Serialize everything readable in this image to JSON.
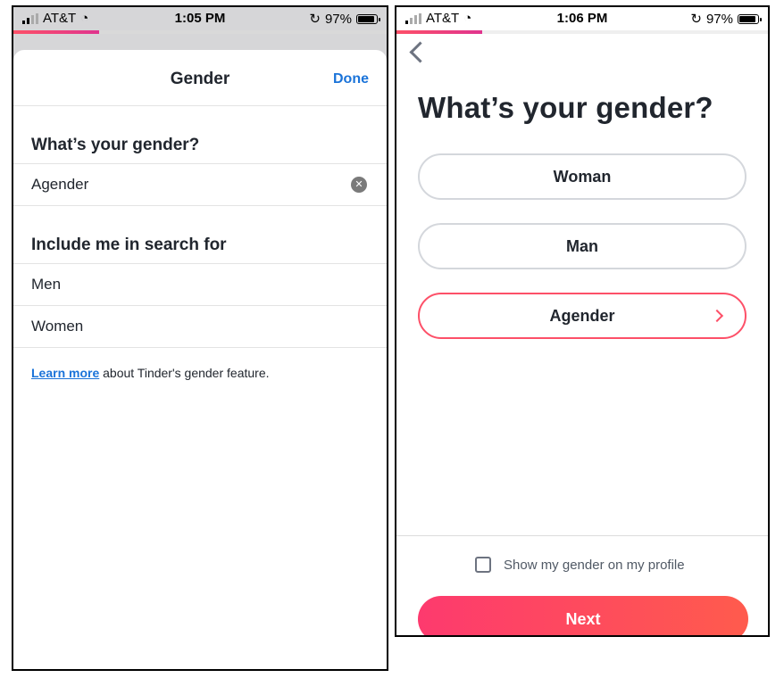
{
  "left": {
    "status": {
      "carrier": "AT&T",
      "time": "1:05 PM",
      "battery": "97%"
    },
    "progress": 0.23,
    "header": {
      "title": "Gender",
      "done": "Done"
    },
    "gender_section": {
      "heading": "What’s your gender?",
      "value": "Agender"
    },
    "search_section": {
      "heading": "Include me in search for",
      "options": [
        "Men",
        "Women"
      ]
    },
    "learn": {
      "link": "Learn more",
      "rest": " about Tinder's gender feature."
    }
  },
  "right": {
    "status": {
      "carrier": "AT&T",
      "time": "1:06 PM",
      "battery": "97%"
    },
    "progress": 0.23,
    "title": "What’s your gender?",
    "options": [
      "Woman",
      "Man",
      "Agender"
    ],
    "selected": "Agender",
    "show_on_profile": "Show my gender on my profile",
    "next": "Next",
    "colors": {
      "accent": "#fd5068",
      "text": "#21262e",
      "link": "#1a73d9"
    }
  }
}
